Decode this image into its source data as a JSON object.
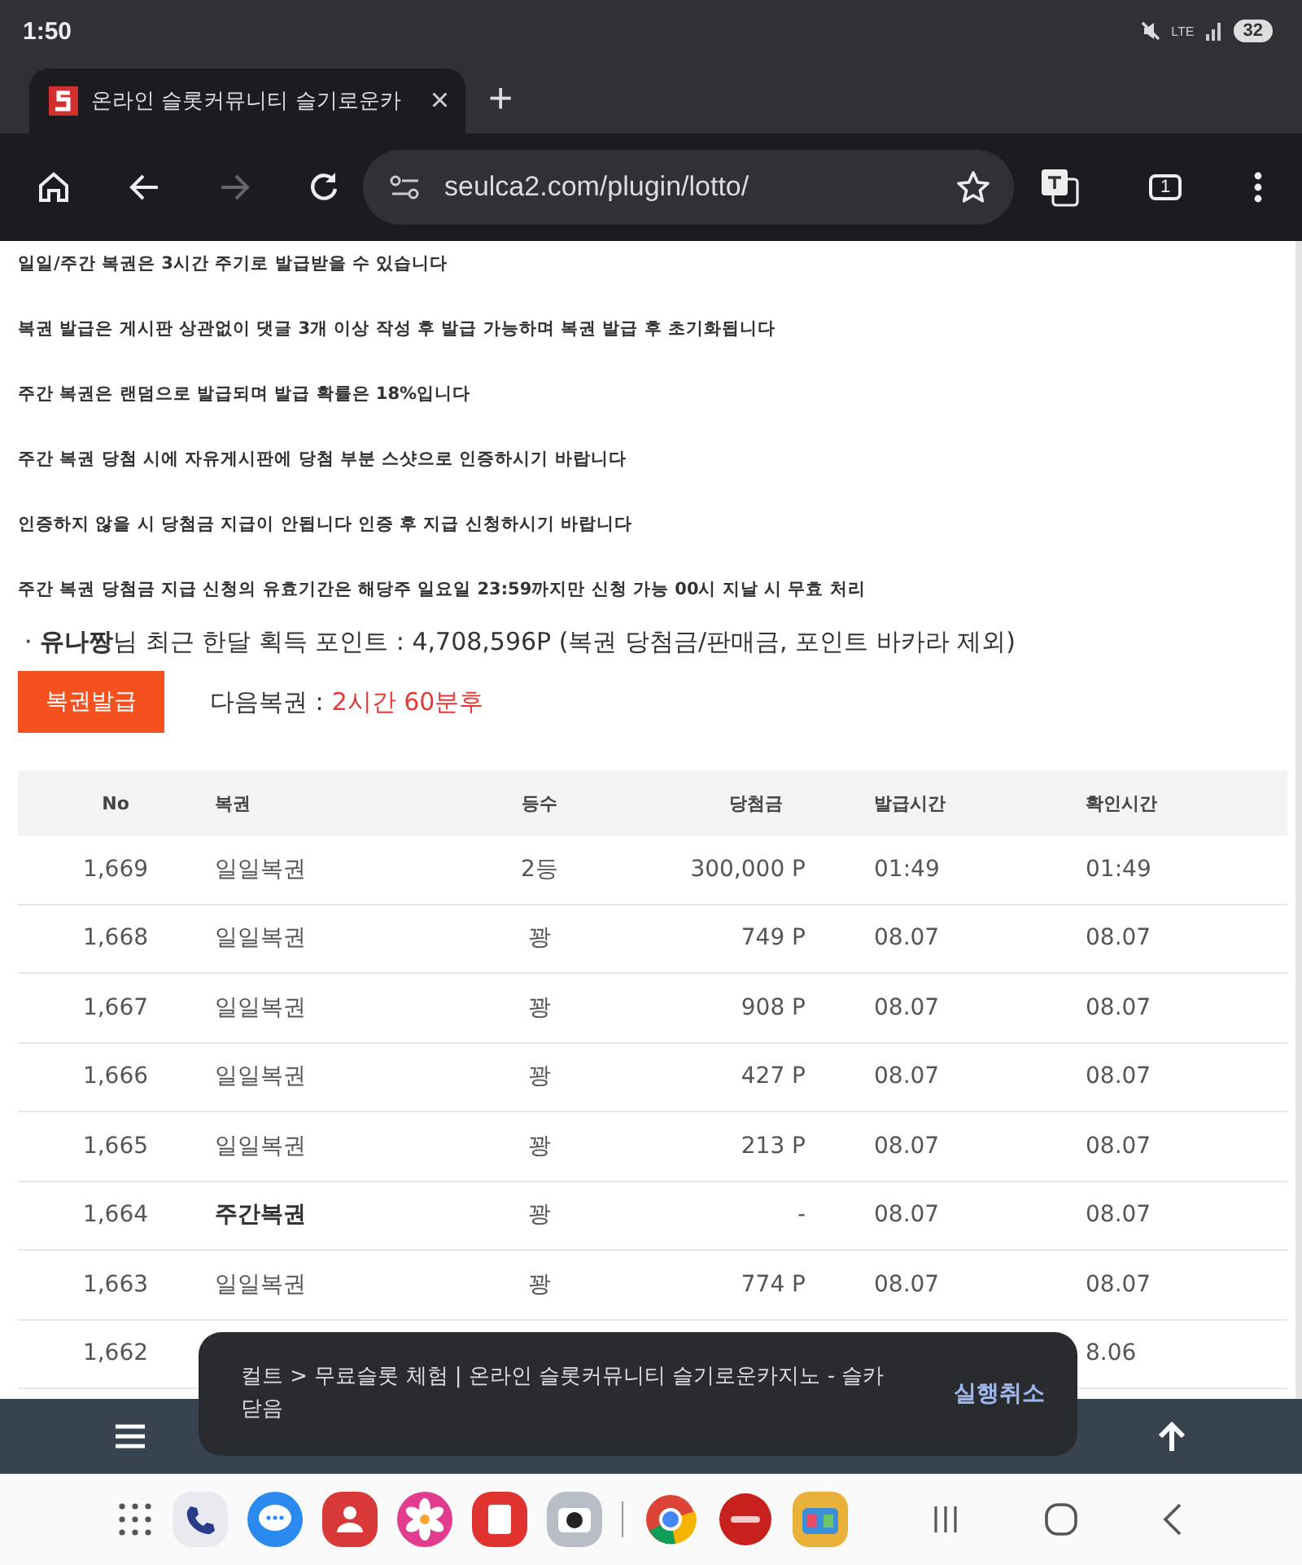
{
  "status_bar": {
    "time": "1:50",
    "network": "LTE",
    "battery": "32"
  },
  "tab": {
    "title": "온라인 슬롯커뮤니티 슬기로운카",
    "close": "×",
    "new_tab": "+"
  },
  "toolbar": {
    "url": "seulca2.com/plugin/lotto/",
    "tab_count": "1",
    "forward_disabled": true
  },
  "notices": [
    "일일/주간 복권은 3시간 주기로 발급받을 수 있습니다",
    "복권 발급은 게시판 상관없이 댓글 3개 이상 작성 후 발급 가능하며 복권 발급 후 초기화됩니다",
    "주간 복권은 랜덤으로 발급되며 발급 확률은 18%입니다",
    "주간 복권 당첨 시에 자유게시판에 당첨 부분 스샷으로 인증하시기 바랍니다",
    "인증하지 않을 시 당첨금 지급이 안됩니다 인증 후 지급 신청하시기 바랍니다",
    "주간 복권 당첨금 지급 신청의 유효기간은 해당주 일요일 23:59까지만 신청 가능 00시 지날 시 무효 처리"
  ],
  "points_line": "· **유나짱**님 최근 한달 획득 포인트 : 4,708,596P (복권 당첨금/판매금, 포인트 바카라 제외)",
  "issue_button": "복권발급",
  "next_ticket": {
    "label": "다음복권 :",
    "value": "2시간 60분후"
  },
  "table": {
    "columns": [
      "No",
      "복권",
      "등수",
      "당첨금",
      "발급시간",
      "확인시간"
    ],
    "rows": [
      {
        "no": "1,669",
        "ticket": "일일복권",
        "kind": "daily",
        "rank": "2등",
        "prize": "300,000 P",
        "issued": "01:49",
        "checked": "01:49"
      },
      {
        "no": "1,668",
        "ticket": "일일복권",
        "kind": "daily",
        "rank": "꽝",
        "prize": "749 P",
        "issued": "08.07",
        "checked": "08.07"
      },
      {
        "no": "1,667",
        "ticket": "일일복권",
        "kind": "daily",
        "rank": "꽝",
        "prize": "908 P",
        "issued": "08.07",
        "checked": "08.07"
      },
      {
        "no": "1,666",
        "ticket": "일일복권",
        "kind": "daily",
        "rank": "꽝",
        "prize": "427 P",
        "issued": "08.07",
        "checked": "08.07"
      },
      {
        "no": "1,665",
        "ticket": "일일복권",
        "kind": "daily",
        "rank": "꽝",
        "prize": "213 P",
        "issued": "08.07",
        "checked": "08.07"
      },
      {
        "no": "1,664",
        "ticket": "주간복권",
        "kind": "weekly",
        "rank": "꽝",
        "prize": "-",
        "issued": "08.07",
        "checked": "08.07"
      },
      {
        "no": "1,663",
        "ticket": "일일복권",
        "kind": "daily",
        "rank": "꽝",
        "prize": "774 P",
        "issued": "08.07",
        "checked": "08.07"
      },
      {
        "no": "1,662",
        "checked": "8.06"
      }
    ]
  },
  "snackbar": {
    "message": "컬트 > 무료슬롯 체험 | 온라인 슬롯커뮤니티 슬기로운카지노 - 슬카 닫음",
    "action": "실행취소"
  }
}
